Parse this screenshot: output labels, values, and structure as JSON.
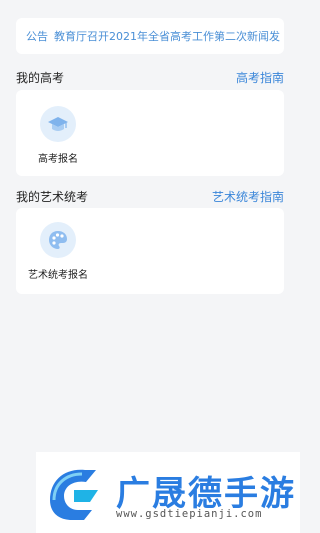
{
  "notice": {
    "tag": "公告",
    "text": "教育厅召开2021年全省高考工作第二次新闻发"
  },
  "gaokao_section": {
    "title": "我的高考",
    "link": "高考指南",
    "tiles": [
      {
        "label": "高考报名",
        "icon": "graduation-cap-icon"
      }
    ]
  },
  "art_section": {
    "title": "我的艺术统考",
    "link": "艺术统考指南",
    "tiles": [
      {
        "label": "艺术统考报名",
        "icon": "palette-icon"
      }
    ]
  },
  "watermark": {
    "title": "广晟德手游",
    "url": "www.gsdtiepianji.com"
  },
  "colors": {
    "accent": "#3a86d9",
    "notice_text": "#4a8fd6",
    "background": "#f4f5f7",
    "watermark_blue": "#2a7de1"
  }
}
